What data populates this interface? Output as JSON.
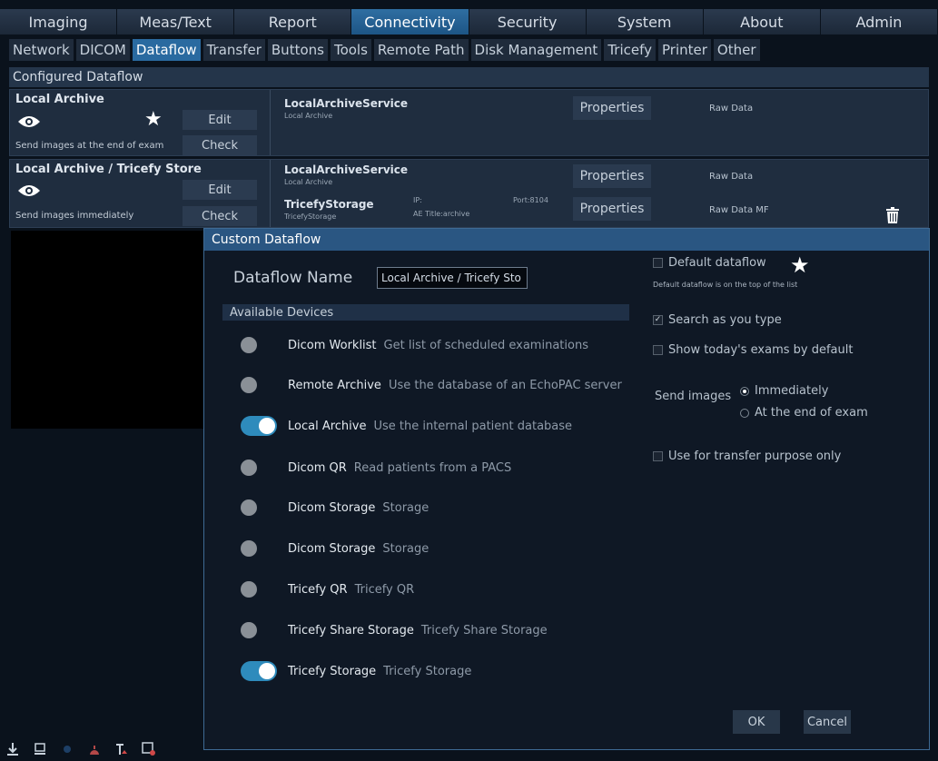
{
  "top_tabs": [
    "Imaging",
    "Meas/Text",
    "Report",
    "Connectivity",
    "Security",
    "System",
    "About",
    "Admin"
  ],
  "sub_tabs": [
    "Network",
    "DICOM",
    "Dataflow",
    "Transfer",
    "Buttons",
    "Tools",
    "Remote Path",
    "Disk Management",
    "Tricefy",
    "Printer",
    "Other"
  ],
  "section_title": "Configured Dataflow",
  "dataflows": [
    {
      "title": "Local Archive",
      "send_text": "Send images at the end of exam",
      "edit_label": "Edit",
      "check_label": "Check",
      "service_name": "LocalArchiveService",
      "service_sub": "Local Archive",
      "properties_label": "Properties",
      "raw": "Raw Data"
    },
    {
      "title": "Local Archive / Tricefy Store",
      "send_text": "Send images immediately",
      "edit_label": "Edit",
      "check_label": "Check",
      "service_name": "LocalArchiveService",
      "service_sub": "Local Archive",
      "properties_label": "Properties",
      "raw": "Raw Data",
      "service2_name": "TricefyStorage",
      "service2_sub": "TricefyStorage",
      "service2_ip": "IP:",
      "service2_ae": "AE Title:archive",
      "service2_port": "Port:8104",
      "properties2_label": "Properties",
      "raw2": "Raw Data  MF"
    }
  ],
  "dialog": {
    "title": "Custom Dataflow",
    "name_label": "Dataflow Name",
    "name_value": "Local Archive / Tricefy Sto",
    "available_devices": "Available Devices",
    "devices": [
      {
        "name": "Dicom Worklist",
        "desc": "Get list of scheduled examinations",
        "on": false
      },
      {
        "name": "Remote Archive",
        "desc": "Use the database of an EchoPAC server",
        "on": false
      },
      {
        "name": "Local Archive",
        "desc": "Use the internal patient database",
        "on": true
      },
      {
        "name": "Dicom QR",
        "desc": "Read patients from a PACS",
        "on": false
      },
      {
        "name": "Dicom Storage",
        "desc": "Storage",
        "on": false
      },
      {
        "name": "Dicom Storage",
        "desc": "Storage",
        "on": false
      },
      {
        "name": "Tricefy QR",
        "desc": "Tricefy QR",
        "on": false
      },
      {
        "name": "Tricefy Share Storage",
        "desc": "Tricefy Share Storage",
        "on": false
      },
      {
        "name": "Tricefy Storage",
        "desc": "Tricefy Storage",
        "on": true
      }
    ],
    "default_dataflow": "Default dataflow",
    "default_hint": "Default dataflow is on the top of the list",
    "search_as_you_type": "Search as you type",
    "show_today": "Show today's exams by default",
    "send_images_label": "Send images",
    "immediately": "Immediately",
    "end_of_exam": "At the end of exam",
    "transfer_only": "Use for transfer purpose only",
    "ok": "OK",
    "cancel": "Cancel",
    "checkmark": "✓"
  },
  "accent": "#2a6aa0"
}
